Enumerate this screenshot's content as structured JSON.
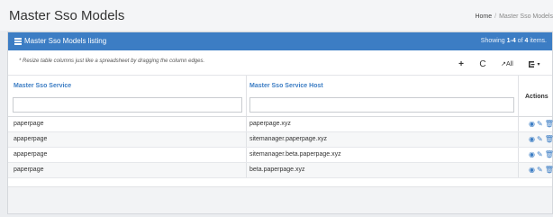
{
  "header": {
    "title": "Master Sso Models",
    "breadcrumb_home": "Home",
    "breadcrumb_sep": "/",
    "breadcrumb_current": "Master Sso Models"
  },
  "panel": {
    "title": "Master Sso Models listing",
    "summary_prefix": "Showing",
    "summary_range": "1-4",
    "summary_mid": "of",
    "summary_total": "4",
    "summary_suffix": "items.",
    "hint": "* Resize table columns just like a spreadsheet by dragging the column edges."
  },
  "toolbar": {
    "add_icon": "+",
    "refresh_icon": "C",
    "all_label": "All",
    "export_icon": "export-icon"
  },
  "table": {
    "columns": {
      "service": "Master Sso Service",
      "host": "Master Sso Service Host",
      "actions": "Actions"
    },
    "rows": [
      {
        "service": "paperpage",
        "host": "paperpage.xyz"
      },
      {
        "service": "apaperpage",
        "host": "sitemanager.paperpage.xyz"
      },
      {
        "service": "apaperpage",
        "host": "sitemanager.beta.paperpage.xyz"
      },
      {
        "service": "paperpage",
        "host": "beta.paperpage.xyz"
      }
    ]
  },
  "colors": {
    "accent": "#3c7dc4",
    "background": "#ebedf0"
  }
}
